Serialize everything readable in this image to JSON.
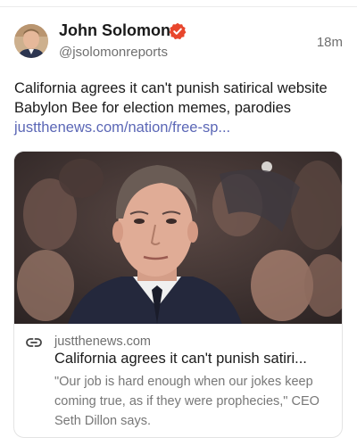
{
  "author": {
    "name": "John Solomon",
    "handle": "@jsolomonreports",
    "verified_icon": "verified-badge-icon",
    "verified_color": "#e8462c"
  },
  "post": {
    "timestamp": "18m",
    "text": "California agrees it can't punish satirical website Babylon Bee for election memes, parodies ",
    "link_text": "justthenews.com/nation/free-sp...",
    "link_color": "#5b67b6"
  },
  "card": {
    "image_description_icon": "photo",
    "domain_icon": "link-icon",
    "domain": "justthenews.com",
    "title": "California agrees it can't punish satiri...",
    "description": "\"Our job is hard enough when our jokes keep coming true, as if they were prophecies,\" CEO Seth Dillon says."
  }
}
